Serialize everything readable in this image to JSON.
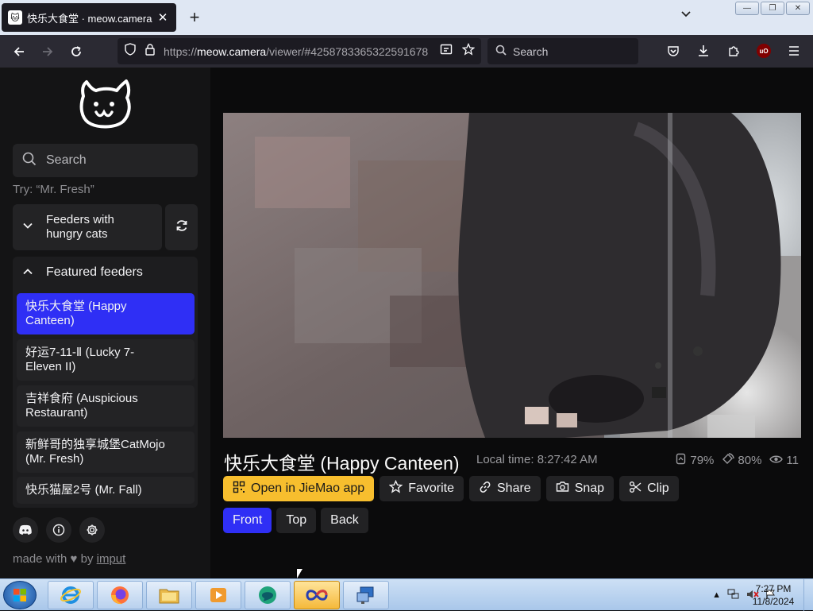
{
  "browser": {
    "tab_title": "快乐大食堂 · meow.camera",
    "url_prefix": "https://",
    "url_host": "meow.camera",
    "url_path": "/viewer/#4258783365322591678",
    "search_placeholder": "Search"
  },
  "sidebar": {
    "search_placeholder": "Search",
    "search_hint": "Try: “Mr. Fresh”",
    "group_hungry": "Feeders with hungry cats",
    "featured_header": "Featured feeders",
    "feeders": [
      {
        "label": "快乐大食堂 (Happy Canteen)",
        "active": true
      },
      {
        "label": "好运7-11-Ⅱ (Lucky 7-Eleven II)",
        "active": false
      },
      {
        "label": "吉祥食府 (Auspicious Restaurant)",
        "active": false
      },
      {
        "label": "新鲜哥的独享城堡CatMojo (Mr. Fresh)",
        "active": false
      },
      {
        "label": "快乐猫屋2号 (Mr. Fall)",
        "active": false
      }
    ],
    "made_with_prefix": "made with",
    "made_with_by": "by",
    "made_with_author": "imput"
  },
  "viewer": {
    "camera_title": "快乐大食堂 (Happy Canteen)",
    "local_time": "Local time: 8:27:42 AM",
    "food_level": "79%",
    "battery_level": "80%",
    "viewers": "11",
    "actions": {
      "open_app": "Open in JieMao app",
      "favorite": "Favorite",
      "share": "Share",
      "snap": "Snap",
      "clip": "Clip"
    },
    "views": {
      "front": "Front",
      "top": "Top",
      "back": "Back"
    },
    "active_view": "Front"
  },
  "taskbar": {
    "time": "7:27 PM",
    "date": "11/8/2024"
  },
  "colors": {
    "accent": "#2f2ff5",
    "yellow": "#f7be2e"
  }
}
